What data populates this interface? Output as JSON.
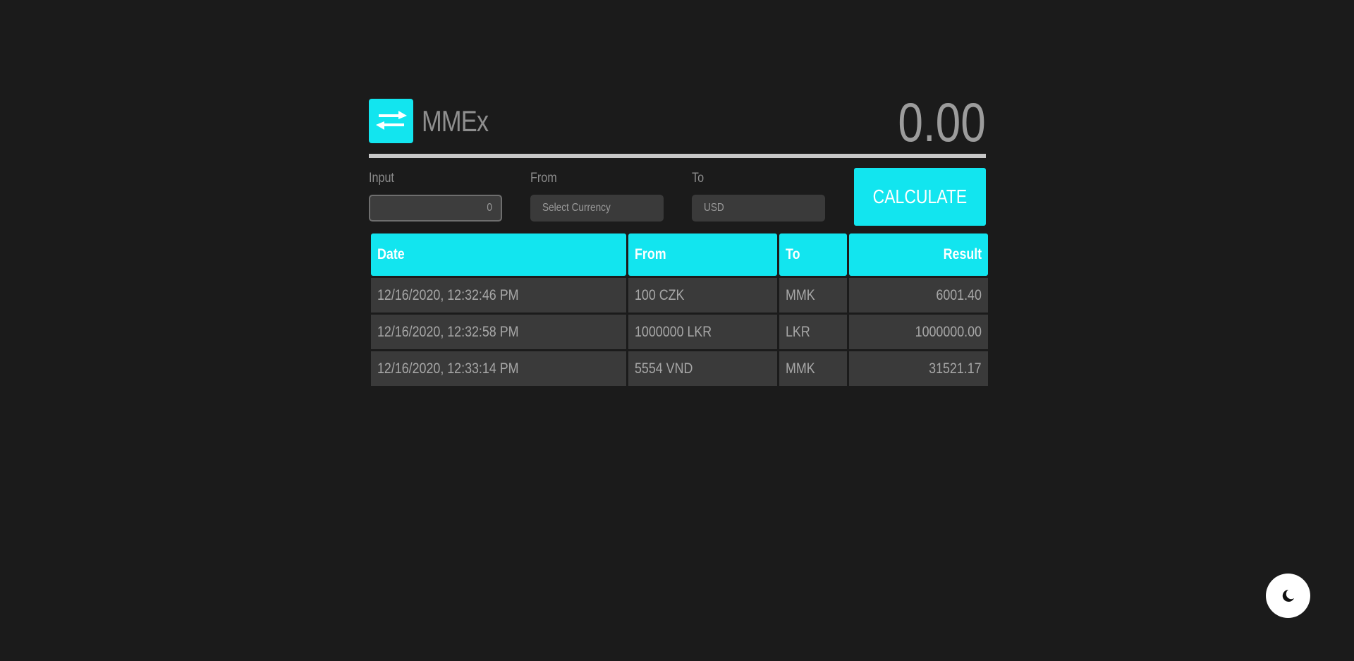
{
  "app": {
    "name": "MMEx",
    "total": "0.00",
    "logo_icon": "swap-arrows-icon",
    "accent": "#12e5ef"
  },
  "form": {
    "input_label": "Input",
    "input_value": "0",
    "from_label": "From",
    "from_value": "Select Currency",
    "to_label": "To",
    "to_value": "USD",
    "calculate_label": "CALCULATE"
  },
  "history": {
    "headers": [
      "Date",
      "From",
      "To",
      "Result"
    ],
    "rows": [
      {
        "date": "12/16/2020, 12:32:46 PM",
        "from": "100 CZK",
        "to": "MMK",
        "result": "6001.40"
      },
      {
        "date": "12/16/2020, 12:32:58 PM",
        "from": "1000000 LKR",
        "to": "LKR",
        "result": "1000000.00"
      },
      {
        "date": "12/16/2020, 12:33:14 PM",
        "from": "5554 VND",
        "to": "MMK",
        "result": "31521.17"
      }
    ]
  },
  "theme_toggle": {
    "icon": "moon-icon"
  }
}
